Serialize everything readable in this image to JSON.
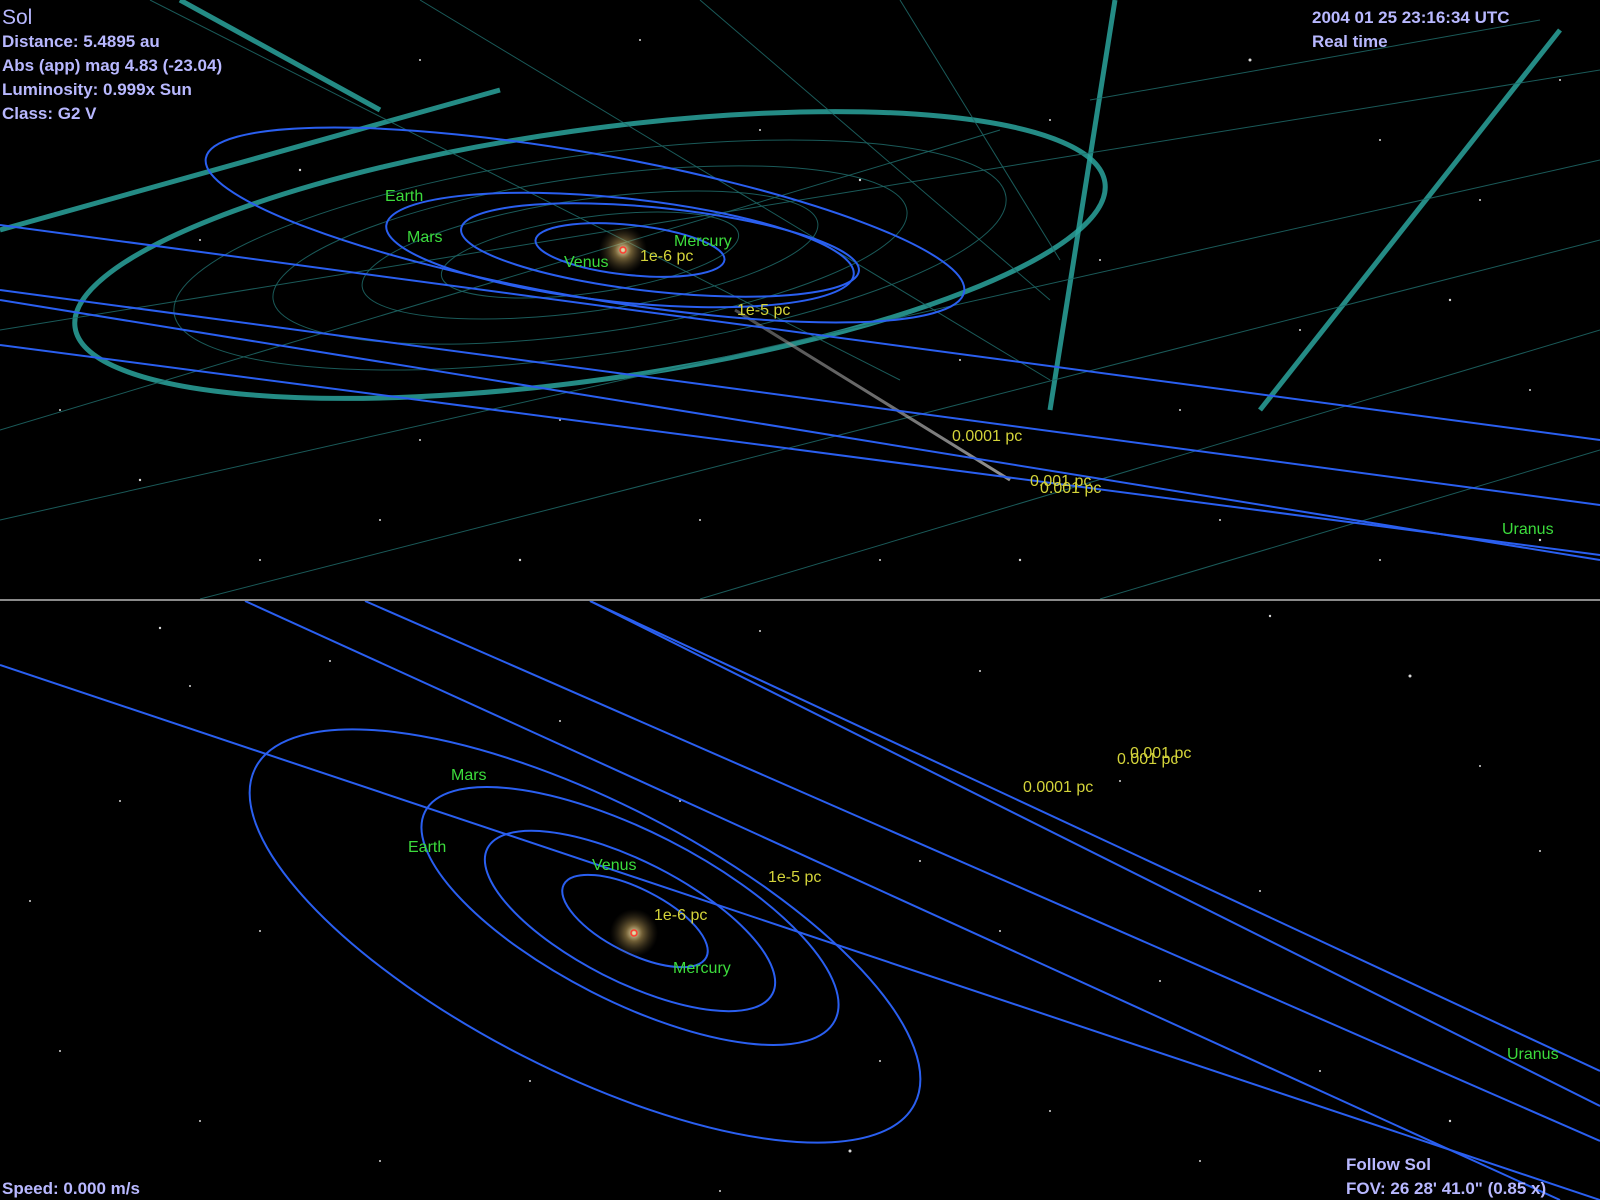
{
  "app": {
    "info": {
      "object_name": "Sol",
      "distance": "Distance: 5.4895 au",
      "abs_app_mag": "Abs (app) mag  4.83 (-23.04)",
      "luminosity": "Luminosity: 0.999x Sun",
      "class": "Class: G2 V"
    },
    "time": {
      "datetime": "2004 01 25 23:16:34 UTC",
      "rate": "Real time"
    },
    "status": {
      "speed": "Speed: 0.000 m/s",
      "follow": "Follow Sol",
      "fov": "FOV: 26 28' 41.0\" (0.85 x)"
    }
  },
  "top_view": {
    "planets": {
      "earth": "Earth",
      "mars": "Mars",
      "mercury": "Mercury",
      "venus": "Venus",
      "uranus": "Uranus"
    },
    "scale_labels": {
      "s1": "1e-6 pc",
      "s2": "1e-5 pc",
      "s3": "0.0001 pc",
      "s4": "0.001 pc"
    }
  },
  "bottom_view": {
    "planets": {
      "mars": "Mars",
      "earth": "Earth",
      "venus": "Venus",
      "mercury": "Mercury",
      "uranus": "Uranus"
    },
    "scale_labels": {
      "s1": "1e-6 pc",
      "s2": "1e-5 pc",
      "s3": "0.0001 pc",
      "s4": "0.001 pc"
    }
  },
  "colors": {
    "hud_text": "#b8b8ff",
    "planet_label": "#3cdc3c",
    "scale_label": "#d4d43a",
    "orbit": "#2a5ff0",
    "grid": "#2aa39c",
    "sun": "#ff3b2f"
  }
}
